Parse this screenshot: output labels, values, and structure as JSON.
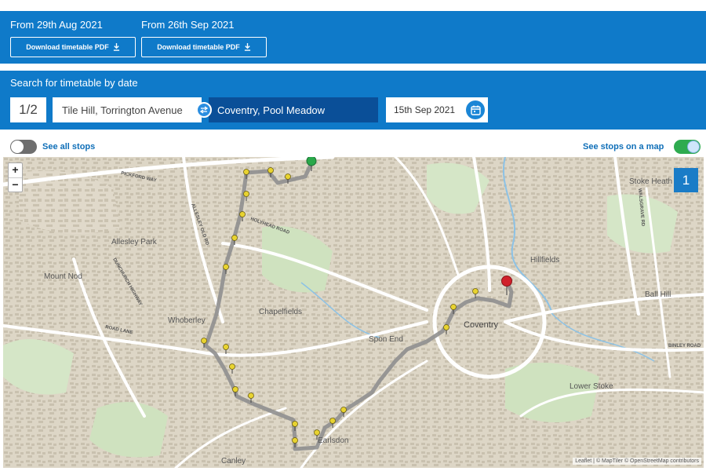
{
  "downloads": [
    {
      "period_label": "From 29th Aug 2021",
      "button_label": "Download timetable PDF"
    },
    {
      "period_label": "From 26th Sep 2021",
      "button_label": "Download timetable PDF"
    }
  ],
  "search": {
    "title": "Search for timetable by date",
    "page_indicator": "1/2",
    "from": "Tile Hill, Torrington Avenue",
    "to": "Coventry, Pool Meadow",
    "date": "15th Sep 2021"
  },
  "toggles": {
    "see_all_stops": {
      "label": "See all stops",
      "on": false
    },
    "see_stops_on_map": {
      "label": "See stops on a map",
      "on": true
    }
  },
  "map": {
    "zoom_in": "+",
    "zoom_out": "−",
    "page_marker": "1",
    "labels": {
      "stoke_heath": "Stoke Heath",
      "allesley_park": "Allesley Park",
      "mount_nod": "Mount Nod",
      "chapelfields": "Chapelfields",
      "whoberley": "Whoberley",
      "spon_end": "Spon End",
      "coventry": "Coventry",
      "hillfields": "Hillfields",
      "ball_hill": "Ball Hill",
      "lower_stoke": "Lower Stoke",
      "earlsdon": "Earlsdon",
      "canley": "Canley",
      "pickford_way": "PICKFORD WAY",
      "holyhead_road": "HOLYHEAD ROAD",
      "allesley_old_rd": "ALLESLEY OLD RD",
      "road_lane": "ROAD LANE",
      "dunchurch_highway": "DUNCHURCH HIGHWAY",
      "binley_road": "BINLEY ROAD",
      "walsgrave_rd": "WALSGRAVE RD"
    },
    "attribution": "Leaflet | © MapTiler © OpenStreetMap contributors",
    "colors": {
      "route": "#8f8f8f",
      "stop": "#e8d330",
      "start": "#2aa84a",
      "end": "#d0202a"
    }
  }
}
